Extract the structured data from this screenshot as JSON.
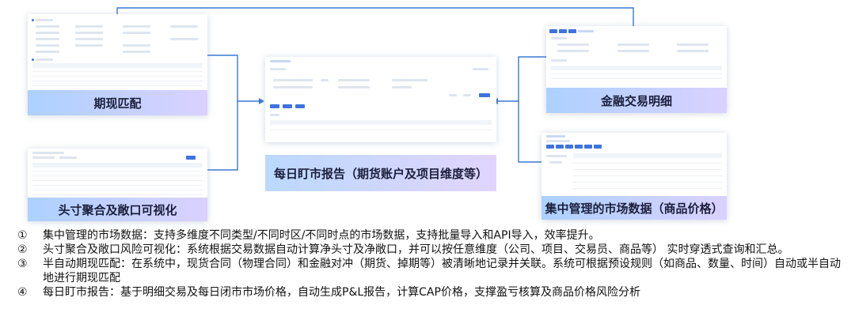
{
  "panels": {
    "top_left": {
      "label": "期现匹配"
    },
    "bottom_left": {
      "label": "头寸聚合及敞口可视化"
    },
    "center": {
      "label": "每日盯市报告（期货账户及项目维度等）"
    },
    "top_right": {
      "label": "金融交易明细"
    },
    "bottom_right": {
      "label": "集中管理的市场数据（商品价格）"
    }
  },
  "colors": {
    "arrow": "#3a78d6",
    "band_start": "#a5cdff",
    "band_end": "#d7cdff",
    "accent": "#3d73e0"
  },
  "list": [
    {
      "num": "①",
      "text": "集中管理的市场数据：支持多维度不同类型/不同时区/不同时点的市场数据，支持批量导入和API导入，效率提升。"
    },
    {
      "num": "②",
      "text": "头寸聚合及敞口风险可视化：系统根据交易数据自动计算净头寸及净敞口，并可以按任意维度（公司、项目、交易员、商品等） 实时穿透式查询和汇总。"
    },
    {
      "num": "③",
      "text": "半自动期现匹配：在系统中，现货合同（物理合同）和金融对冲（期货、掉期等）被清晰地记录并关联。系统可根据预设规则（如商品、数量、时间）自动或半自动地进行期现匹配"
    },
    {
      "num": "④",
      "text": "每日盯市报告：基于明细交易及每日闭市市场价格，自动生成P&L报告，计算CAP价格，支撑盈亏核算及商品价格风险分析"
    }
  ]
}
